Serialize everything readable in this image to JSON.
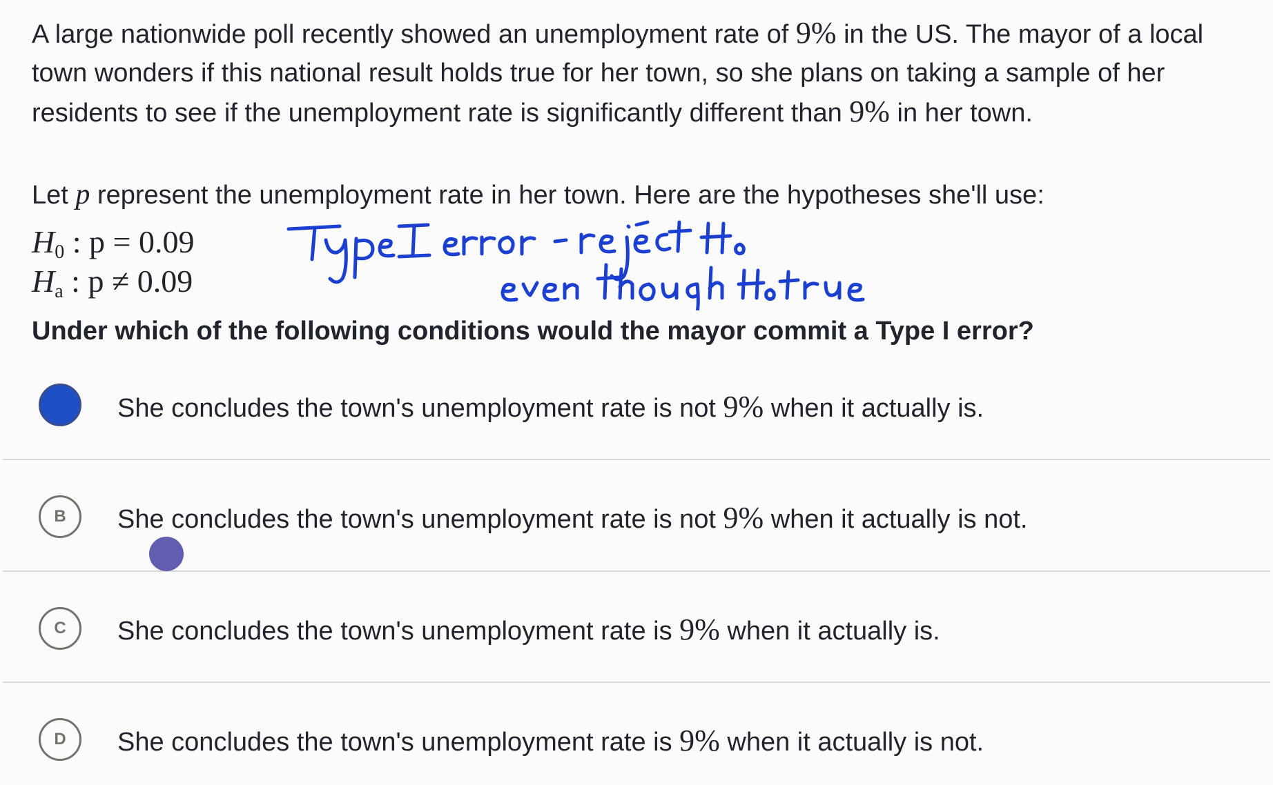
{
  "problem": {
    "stem_part1": "A large nationwide poll recently showed an unemployment rate of ",
    "stem_pct1": "9%",
    "stem_part2": " in the US. The mayor of a local town wonders if this national result holds true for her town, so she plans on taking a sample of her residents to see if the unemployment rate is significantly different than ",
    "stem_pct2": "9%",
    "stem_part3": " in her town.",
    "lead_part1": "Let ",
    "lead_var": "p",
    "lead_part2": " represent the unemployment rate in her town. Here are the hypotheses she'll use:",
    "null_hypothesis": {
      "symbol": "H",
      "subscript": "0",
      "relation": " : p = 0.09"
    },
    "alt_hypothesis": {
      "symbol": "H",
      "subscript": "a",
      "relation": " : p ≠ 0.09"
    },
    "question": "Under which of the following conditions would the mayor commit a Type I error?"
  },
  "handwritten_note": {
    "line1": "Type I error - reject H0",
    "line2": "even though H0 true",
    "ink_color": "#1a3fd1"
  },
  "choices": [
    {
      "letter": "A",
      "selected": true,
      "text_before": "She concludes the town's unemployment rate is not ",
      "pct": "9%",
      "text_after": " when it actually is."
    },
    {
      "letter": "B",
      "selected": false,
      "text_before": "She concludes the town's unemployment rate is not ",
      "pct": "9%",
      "text_after": " when it actually is not."
    },
    {
      "letter": "C",
      "selected": false,
      "text_before": "She concludes the town's unemployment rate is ",
      "pct": "9%",
      "text_after": " when it actually is."
    },
    {
      "letter": "D",
      "selected": false,
      "text_before": "She concludes the town's unemployment rate is ",
      "pct": "9%",
      "text_after": " when it actually is not."
    }
  ],
  "colors": {
    "text": "#21242c",
    "selected_fill": "#1e4fc4",
    "divider": "#d6d8da",
    "cursor": "#5450a8"
  }
}
